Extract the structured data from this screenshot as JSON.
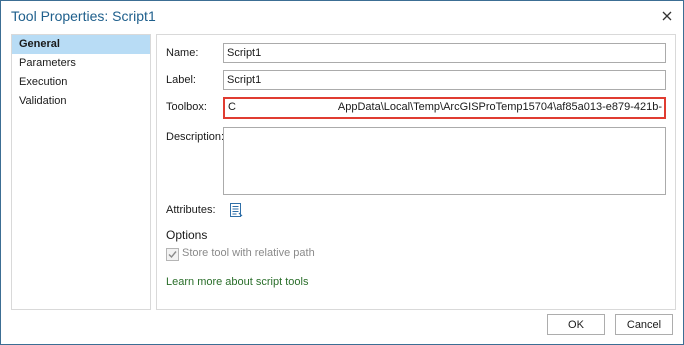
{
  "window": {
    "title": "Tool Properties: Script1",
    "close_icon": "close-icon"
  },
  "nav": {
    "items": [
      {
        "label": "General",
        "active": true
      },
      {
        "label": "Parameters",
        "active": false
      },
      {
        "label": "Execution",
        "active": false
      },
      {
        "label": "Validation",
        "active": false
      }
    ]
  },
  "general": {
    "name_label": "Name:",
    "name_value": "Script1",
    "label_label": "Label:",
    "label_value": "Script1",
    "toolbox_label": "Toolbox:",
    "toolbox_lead": "C",
    "toolbox_value": "AppData\\Local\\Temp\\ArcGISProTemp15704\\af85a013-e879-421b-",
    "description_label": "Description:",
    "description_value": "",
    "attributes_label": "Attributes:",
    "attributes_icon": "script-document-icon",
    "options_heading": "Options",
    "relative_path_label": "Store tool with relative path",
    "relative_path_checked": true,
    "learn_more_link": "Learn more about script tools"
  },
  "buttons": {
    "ok": "OK",
    "cancel": "Cancel"
  },
  "colors": {
    "title": "#1e5f8c",
    "nav_active": "#b8dcf5",
    "highlight_border": "#e03c31",
    "link": "#2a6e2a"
  }
}
